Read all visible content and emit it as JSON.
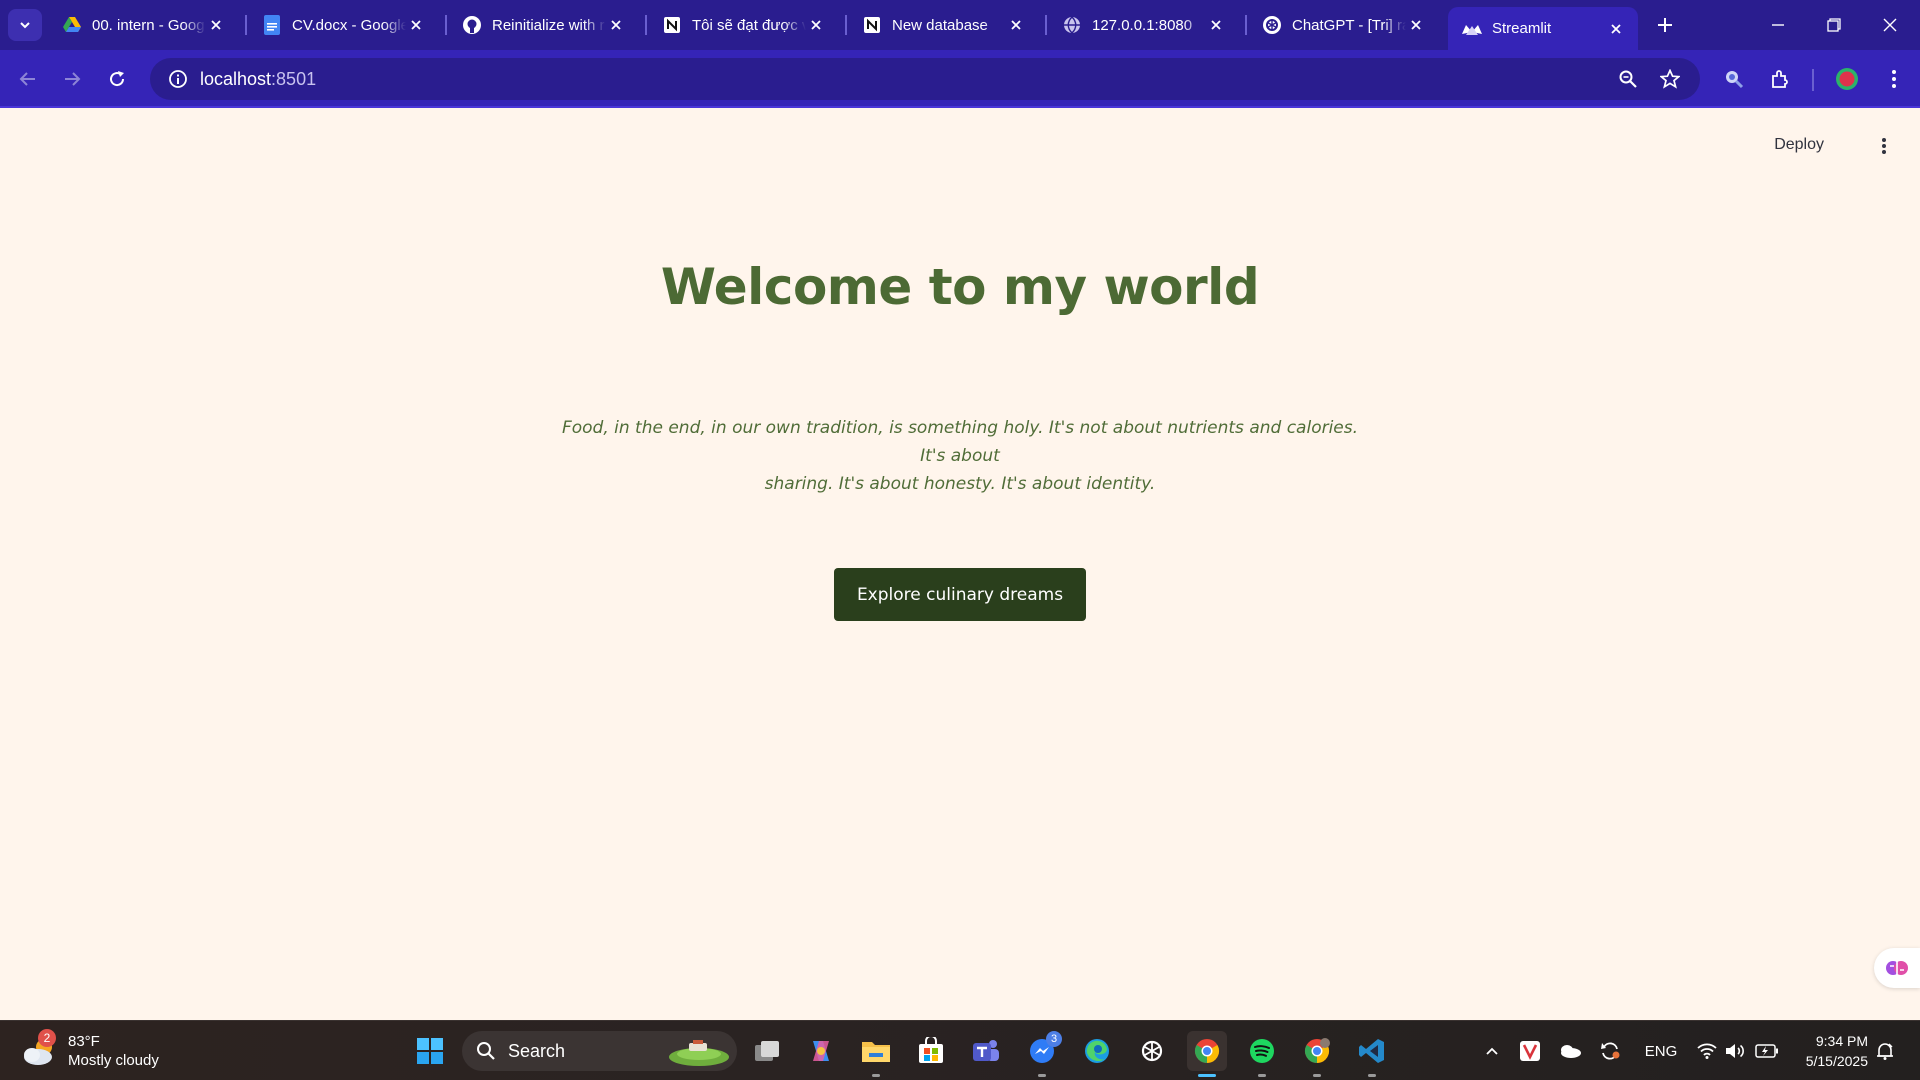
{
  "browser": {
    "tabs": [
      {
        "title": "00. intern - Goog",
        "favicon": "google-drive-icon"
      },
      {
        "title": "CV.docx - Google",
        "favicon": "google-docs-icon"
      },
      {
        "title": "Reinitialize with r",
        "favicon": "github-icon"
      },
      {
        "title": "Tôi sẽ đạt được v",
        "favicon": "notion-icon"
      },
      {
        "title": "New database",
        "favicon": "notion-icon"
      },
      {
        "title": "127.0.0.1:8080",
        "favicon": "globe-icon"
      },
      {
        "title": "ChatGPT - [Tri] ra",
        "favicon": "openai-icon"
      },
      {
        "title": "Streamlit",
        "favicon": "streamlit-icon",
        "active": true
      }
    ],
    "address": {
      "host": "localhost",
      "port": ":8501"
    }
  },
  "page": {
    "deploy_label": "Deploy",
    "title": "Welcome to my world",
    "quote_line1": "Food, in the end, in our own tradition, is something holy. It's not about nutrients and calories. It's about",
    "quote_line2": "sharing. It's about honesty. It's about identity.",
    "cta_label": "Explore culinary dreams"
  },
  "taskbar": {
    "weather": {
      "temp": "83°F",
      "condition": "Mostly cloudy",
      "badge": "2"
    },
    "search_label": "Search",
    "messenger_badge": "3",
    "language": "ENG",
    "time": "9:34 PM",
    "date": "5/15/2025"
  },
  "colors": {
    "tab_strip": "#2a1d8f",
    "toolbar": "#3524b7",
    "page_bg": "#fff5ec",
    "title_green": "#4c6a34",
    "button_green": "#2a3f1c"
  }
}
